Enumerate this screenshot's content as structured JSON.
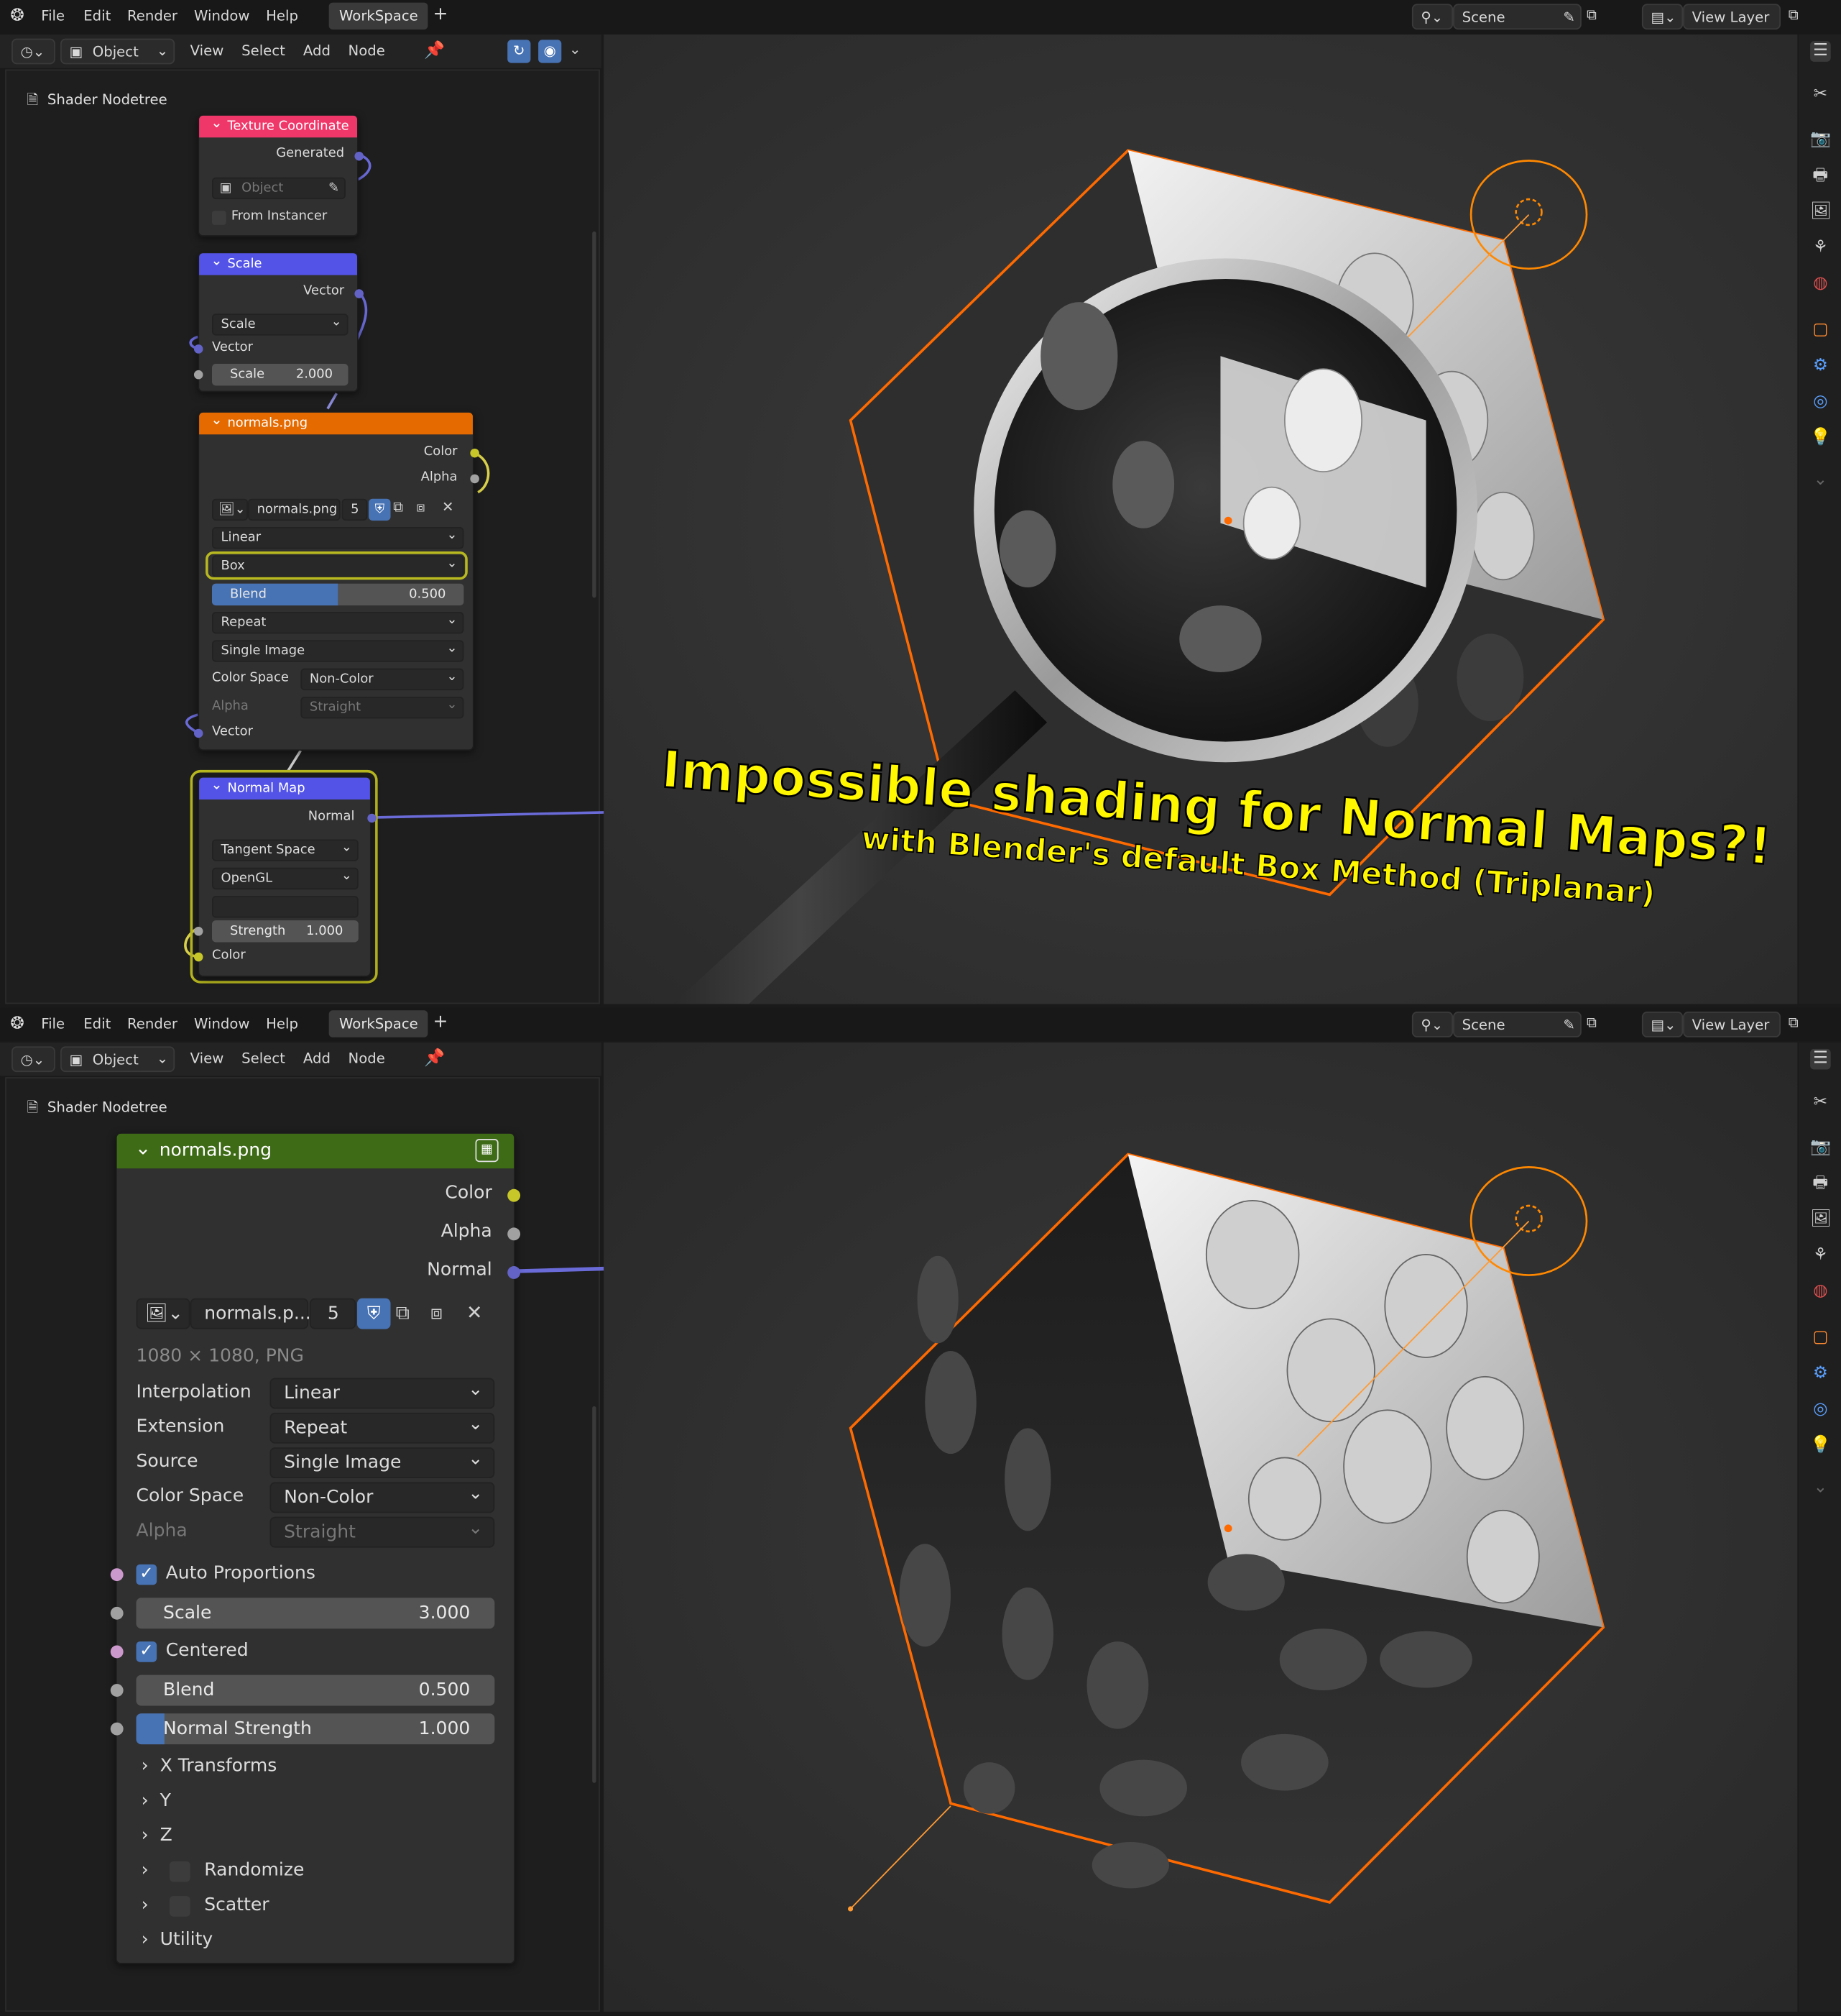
{
  "top": {
    "menus": [
      "File",
      "Edit",
      "Render",
      "Window",
      "Help"
    ],
    "workspace_tab": "WorkSpace",
    "add_tab": "+",
    "scene_label": "Scene",
    "view_layer_label": "View Layer"
  },
  "editor_header": {
    "mode": "Object",
    "menus": [
      "View",
      "Select",
      "Add",
      "Node"
    ]
  },
  "breadcrumb": "Shader Nodetree",
  "top_nodes": {
    "tex_coord": {
      "title": "Texture Coordinate",
      "output": "Generated",
      "object_placeholder": "Object",
      "from_instancer": "From Instancer"
    },
    "scale": {
      "title": "Scale",
      "output": "Vector",
      "op": "Scale",
      "input_vector": "Vector",
      "scale_label": "Scale",
      "scale_value": "2.000"
    },
    "image": {
      "title": "normals.png",
      "out_color": "Color",
      "out_alpha": "Alpha",
      "file": "normals.png",
      "users": "5",
      "interpolation": "Linear",
      "projection": "Box",
      "blend_label": "Blend",
      "blend_value": "0.500",
      "blend_fraction": 0.5,
      "extension": "Repeat",
      "source": "Single Image",
      "color_space_label": "Color Space",
      "color_space": "Non-Color",
      "alpha_label": "Alpha",
      "alpha_mode": "Straight",
      "input_vector": "Vector"
    },
    "normal_map": {
      "title": "Normal Map",
      "output": "Normal",
      "space": "Tangent Space",
      "convention": "OpenGL",
      "strength_label": "Strength",
      "strength_value": "1.000",
      "input_color": "Color"
    }
  },
  "bottom_node": {
    "title": "normals.png",
    "out_color": "Color",
    "out_alpha": "Alpha",
    "out_normal": "Normal",
    "file": "normals.p...",
    "users": "5",
    "info": "1080 × 1080, PNG",
    "interpolation_label": "Interpolation",
    "interpolation": "Linear",
    "extension_label": "Extension",
    "extension": "Repeat",
    "source_label": "Source",
    "source": "Single Image",
    "color_space_label": "Color Space",
    "color_space": "Non-Color",
    "alpha_label": "Alpha",
    "alpha_mode": "Straight",
    "auto_proportions": "Auto Proportions",
    "scale_label": "Scale",
    "scale_value": "3.000",
    "centered": "Centered",
    "blend_label": "Blend",
    "blend_value": "0.500",
    "normal_strength_label": "Normal Strength",
    "normal_strength_value": "1.000",
    "normal_strength_fraction": 0.08,
    "panels": [
      "X Transforms",
      "Y",
      "Z",
      "Randomize",
      "Scatter",
      "Utility"
    ]
  },
  "overlay": {
    "headline": "Impossible shading for Normal Maps?!",
    "subline": "with Blender's default Box Method (Triplanar)"
  },
  "colors": {
    "tex_coord_header": "#f0376a",
    "vector_header": "#5353e8",
    "image_header": "#e56a00",
    "group_header": "#3e6b16",
    "highlight": "#b8b820",
    "selection_orange": "#ff6a00",
    "accent_blue": "#4772b3"
  }
}
